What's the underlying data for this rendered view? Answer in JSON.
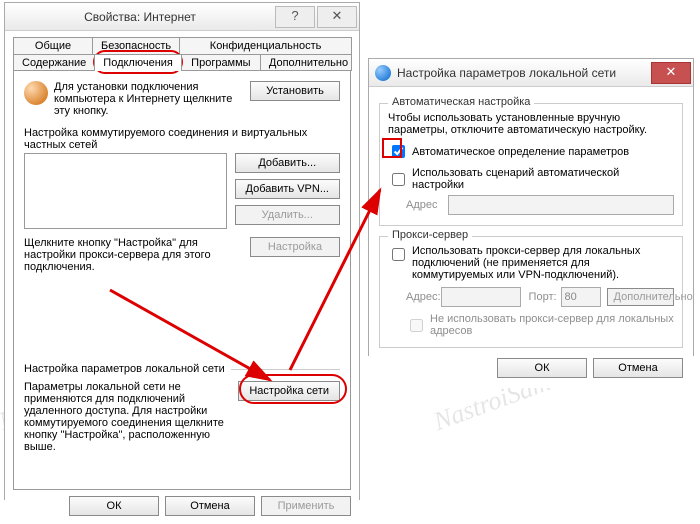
{
  "watermark": "NastroiSam.RU",
  "win1": {
    "titlebar": {
      "help": "?",
      "close": "✕"
    },
    "title": "Свойства: Интернет",
    "tabs_row1": [
      "Общие",
      "Безопасность",
      "Конфиденциальность"
    ],
    "tabs_row2": [
      "Содержание",
      "Подключения",
      "Программы",
      "Дополнительно"
    ],
    "active_tab_index": 1,
    "dialup_text": "Для установки подключения компьютера к Интернету щелкните эту кнопку.",
    "install_btn": "Установить",
    "dialup_heading": "Настройка коммутируемого соединения и виртуальных частных сетей",
    "add_btn": "Добавить...",
    "add_vpn_btn": "Добавить VPN...",
    "remove_btn": "Удалить...",
    "settings_hint": "Щелкните кнопку \"Настройка\" для настройки прокси-сервера для этого подключения.",
    "settings_btn": "Настройка",
    "lan_heading": "Настройка параметров локальной сети",
    "lan_text": "Параметры локальной сети не применяются для подключений удаленного доступа. Для настройки коммутируемого соединения щелкните кнопку \"Настройка\", расположенную выше.",
    "lan_btn": "Настройка сети",
    "bottom": {
      "ok": "ОК",
      "cancel": "Отмена",
      "apply": "Применить"
    }
  },
  "win2": {
    "titlebar": {
      "close": "✕"
    },
    "title": "Настройка параметров локальной сети",
    "auto": {
      "legend": "Автоматическая настройка",
      "text": "Чтобы использовать установленные вручную параметры, отключите автоматическую настройку.",
      "detect_label": "Автоматическое определение параметров",
      "detect_checked": true,
      "script_label": "Использовать сценарий автоматической настройки",
      "script_checked": false,
      "address_label": "Адрес"
    },
    "proxy": {
      "legend": "Прокси-сервер",
      "use_label": "Использовать прокси-сервер для локальных подключений (не применяется для коммутируемых или VPN-подключений).",
      "use_checked": false,
      "address_label": "Адрес:",
      "port_label": "Порт:",
      "port_value": "80",
      "advanced_btn": "Дополнительно",
      "bypass_label": "Не использовать прокси-сервер для локальных адресов",
      "bypass_checked": false
    },
    "ok": "ОК",
    "cancel": "Отмена"
  }
}
